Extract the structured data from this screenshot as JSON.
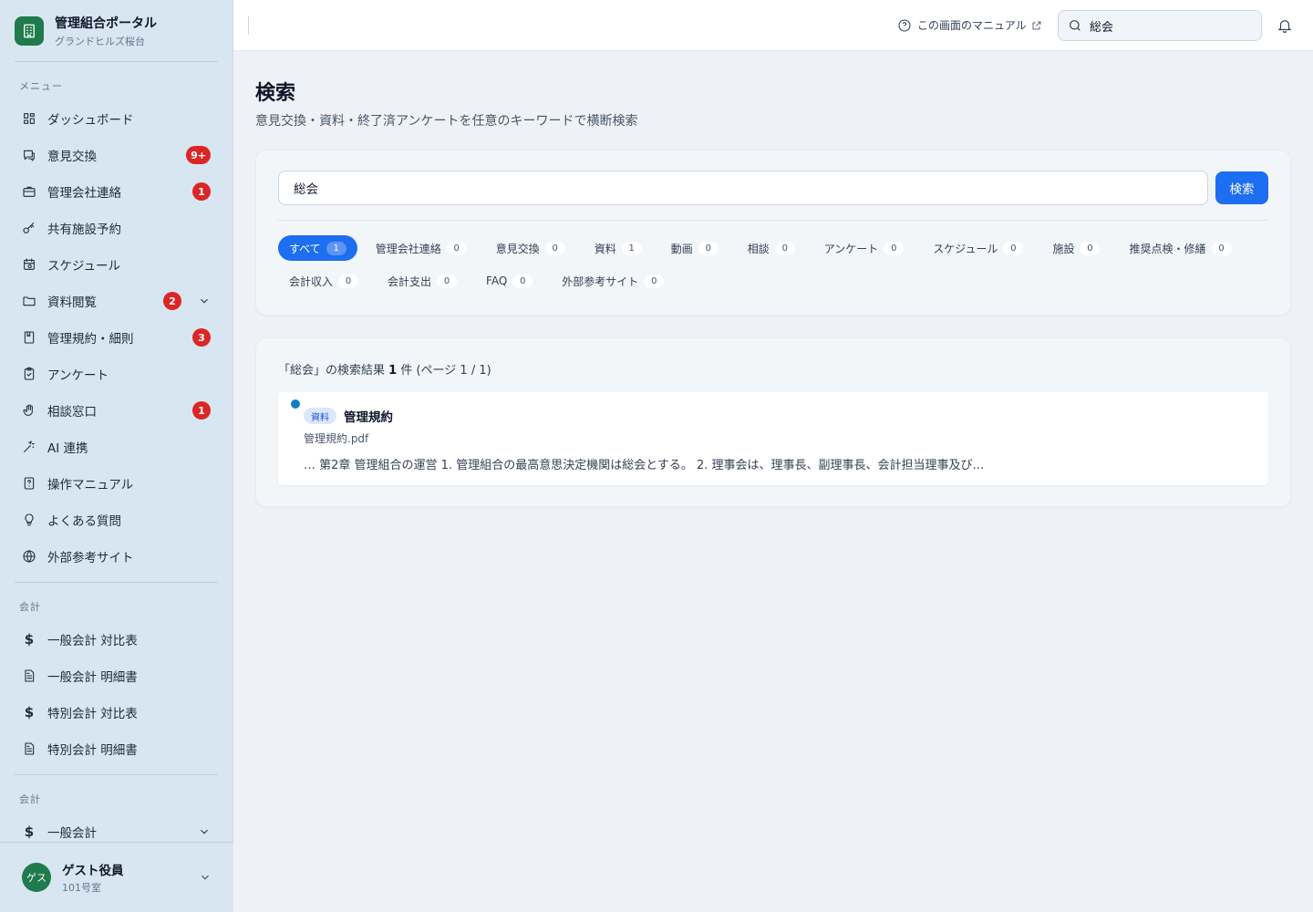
{
  "brand": {
    "title": "管理組合ポータル",
    "subtitle": "グランドヒルズ桜台"
  },
  "sidebar": {
    "menu_label": "メニュー",
    "items": [
      {
        "label": "ダッシュボード",
        "icon": "dashboard-icon"
      },
      {
        "label": "意見交換",
        "icon": "chat-icon",
        "badge": "9+"
      },
      {
        "label": "管理会社連絡",
        "icon": "briefcase-icon",
        "badge": "1"
      },
      {
        "label": "共有施設予約",
        "icon": "key-icon"
      },
      {
        "label": "スケジュール",
        "icon": "calendar-icon"
      },
      {
        "label": "資料閲覧",
        "icon": "folder-icon",
        "badge": "2"
      },
      {
        "label": "管理規約・細則",
        "icon": "book-icon",
        "badge": "3"
      },
      {
        "label": "アンケート",
        "icon": "clipboard-icon"
      },
      {
        "label": "相談窓口",
        "icon": "hand-icon",
        "badge": "1"
      },
      {
        "label": "AI 連携",
        "icon": "sparkle-icon"
      },
      {
        "label": "操作マニュアル",
        "icon": "manual-icon"
      },
      {
        "label": "よくある質問",
        "icon": "lightbulb-icon"
      },
      {
        "label": "外部参考サイト",
        "icon": "globe-icon"
      }
    ],
    "accounting_label": "会計",
    "accounting_items": [
      {
        "label": "一般会計 対比表",
        "icon": "dollar-icon"
      },
      {
        "label": "一般会計 明細書",
        "icon": "document-icon"
      },
      {
        "label": "特別会計 対比表",
        "icon": "dollar-icon"
      },
      {
        "label": "特別会計 明細書",
        "icon": "document-icon"
      }
    ],
    "accounting2_label": "会計",
    "accounting2_items": [
      {
        "label": "一般会計",
        "icon": "dollar-icon"
      }
    ]
  },
  "user": {
    "avatar": "ゲス",
    "name": "ゲスト役員",
    "room": "101号室"
  },
  "topbar": {
    "manual_link": "この画面のマニュアル",
    "search_value": "総会"
  },
  "page": {
    "title": "検索",
    "subtitle": "意見交換・資料・終了済アンケートを任意のキーワードで横断検索"
  },
  "search": {
    "query": "総会",
    "button": "検索",
    "filters": [
      {
        "label": "すべて",
        "count": "1",
        "active": true
      },
      {
        "label": "管理会社連絡",
        "count": "0"
      },
      {
        "label": "意見交換",
        "count": "0"
      },
      {
        "label": "資料",
        "count": "1"
      },
      {
        "label": "動画",
        "count": "0"
      },
      {
        "label": "相談",
        "count": "0"
      },
      {
        "label": "アンケート",
        "count": "0"
      },
      {
        "label": "スケジュール",
        "count": "0"
      },
      {
        "label": "施設",
        "count": "0"
      },
      {
        "label": "推奨点検・修繕",
        "count": "0"
      },
      {
        "label": "会計収入",
        "count": "0"
      },
      {
        "label": "会計支出",
        "count": "0"
      },
      {
        "label": "FAQ",
        "count": "0"
      },
      {
        "label": "外部参考サイト",
        "count": "0"
      }
    ]
  },
  "results": {
    "summary_prefix": "「総会」の検索結果",
    "count": "1",
    "summary_suffix": "件 (ページ 1 / 1)",
    "items": [
      {
        "tag": "資料",
        "title": "管理規約",
        "file": "管理規約.pdf",
        "snippet": "… 第2章 管理組合の運営 1. 管理組合の最高意思決定機関は総会とする。 2. 理事会は、理事長、副理事長、会計担当理事及び…"
      }
    ]
  },
  "colors": {
    "accent": "#1d6ef0",
    "badge": "#dc2626",
    "brand": "#1f7a4c"
  }
}
